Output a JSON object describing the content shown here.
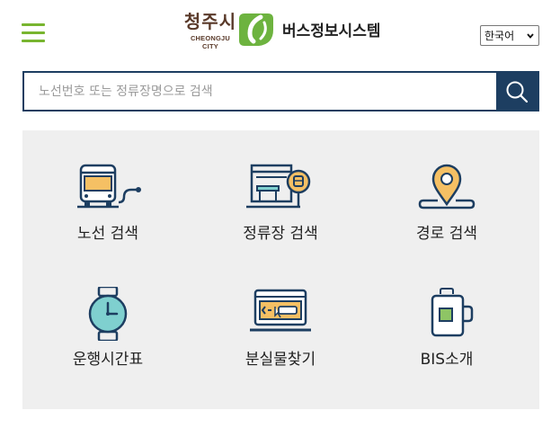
{
  "header": {
    "menu_icon": "hamburger-icon",
    "city_logo_ko": "청주시",
    "city_logo_en": "CHEONGJU CITY",
    "title": "버스정보시스템",
    "language": {
      "selected": "한국어",
      "icon": "chevron-down-icon"
    }
  },
  "search": {
    "placeholder": "노선번호 또는 정류장명으로 검색",
    "value": "",
    "icon": "search-icon"
  },
  "menu": {
    "items": [
      {
        "label": "노선 검색",
        "icon": "bus-route-icon"
      },
      {
        "label": "정류장 검색",
        "icon": "bus-stop-icon"
      },
      {
        "label": "경로 검색",
        "icon": "location-pin-icon"
      },
      {
        "label": "운행시간표",
        "icon": "watch-icon"
      },
      {
        "label": "분실물찾기",
        "icon": "monitor-icon"
      },
      {
        "label": "BIS소개",
        "icon": "mug-icon"
      }
    ]
  },
  "colors": {
    "accent_green": "#78b52f",
    "navy": "#1d3e61",
    "panel_bg": "#efefef",
    "icon_yellow": "#f5c064",
    "icon_teal": "#7fd0cf",
    "icon_green": "#8ec565"
  }
}
